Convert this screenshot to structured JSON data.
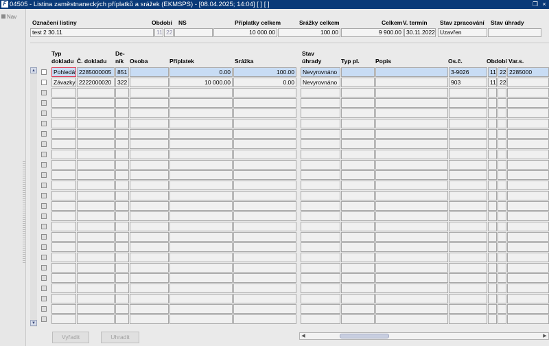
{
  "window": {
    "title": "04505 - Listina zaměstnaneckých příplatků a srážek (EKMSPS) - [08.04.2025; 14:04]  [ ]  [ ]",
    "app_icon": "F",
    "controls": [
      "restore-icon",
      "close-icon"
    ]
  },
  "nav": {
    "label": "Nav"
  },
  "header": {
    "labels": {
      "name": "Označení listiny",
      "period": "Období",
      "ns": "NS",
      "allowances_total": "Příplatky celkem",
      "deductions_total": "Srážky celkem",
      "total": "Celkem",
      "due": "V. termín",
      "processing_state": "Stav zpracování",
      "payment_state": "Stav úhrady"
    },
    "values": {
      "name": "test 2 30.11",
      "period_month": "11",
      "period_year": "22",
      "ns": "",
      "allowances_total": "10 000.00",
      "deductions_total": "100.00",
      "total": "9 900.00",
      "due": "30.11.2022",
      "processing_state": "Uzavřen",
      "payment_state": ""
    }
  },
  "grid": {
    "columns": {
      "doc_type_1": "Typ",
      "doc_type_2": "dokladu",
      "doc_no": "Č. dokladu",
      "journal_1": "De-",
      "journal_2": "ník",
      "person": "Osoba",
      "allowance": "Příplatek",
      "deduction": "Srážka",
      "pay_state_1": "Stav",
      "pay_state_2": "úhrady",
      "pay_type": "Typ pl.",
      "description": "Popis",
      "personal_no": "Os.č.",
      "period": "Období",
      "var_symbol": "Var.s."
    },
    "rows": [
      {
        "doc_type": "Pohledáv",
        "doc_no": "2285000005",
        "journal": "851",
        "person": "",
        "allowance": "0.00",
        "deduction": "100.00",
        "pay_state": "Nevyrovnáno",
        "pay_type": "",
        "description": "",
        "personal_no": "3-9026",
        "period_month": "11",
        "period_year": "22",
        "var_symbol": "2285000"
      },
      {
        "doc_type": "Závazky",
        "doc_no": "2222000020",
        "journal": "322",
        "person": "",
        "allowance": "10 000.00",
        "deduction": "0.00",
        "pay_state": "Nevyrovnáno",
        "pay_type": "",
        "description": "",
        "personal_no": "903",
        "period_month": "11",
        "period_year": "22",
        "var_symbol": ""
      }
    ],
    "empty_row_count": 23
  },
  "buttons": {
    "clear": "Vyřadit",
    "pay": "Uhradit"
  },
  "colors": {
    "title_bar": "#0a3a78",
    "selected_row": "#c8dcf4",
    "focus_border": "#e0405a"
  }
}
